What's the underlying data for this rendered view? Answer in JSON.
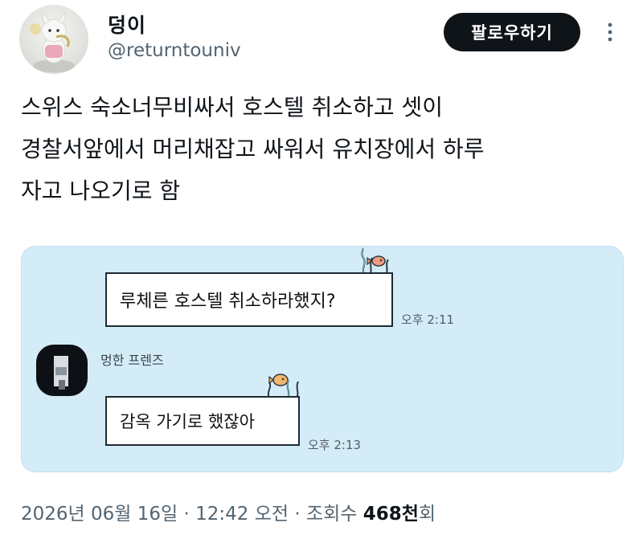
{
  "author": {
    "display_name": "덩이",
    "handle": "@returntouniv"
  },
  "header": {
    "follow_label": "팔로우하기",
    "more_icon": "more-vertical-icon"
  },
  "tweet": {
    "lines": [
      "스위스 숙소너무비싸서 호스텔 취소하고 셋이",
      "경찰서앞에서 머리채잡고 싸워서 유치장에서 하루",
      "자고 나오기로 함"
    ]
  },
  "chat": {
    "messages": [
      {
        "text": "루체른 호스텔 취소하라했지?",
        "time": "오후 2:11"
      },
      {
        "text": "감옥 가기로 했잖아",
        "time": "오후 2:13"
      }
    ],
    "friend_name": "멍한 프렌즈",
    "background": "#d4ecf8"
  },
  "meta": {
    "date": "2026년 06월 16일",
    "sep1": " · ",
    "time": "12:42 오전",
    "sep2": " · ",
    "views_prefix": "조회수 ",
    "views_value": "468천",
    "views_suffix": "회"
  }
}
